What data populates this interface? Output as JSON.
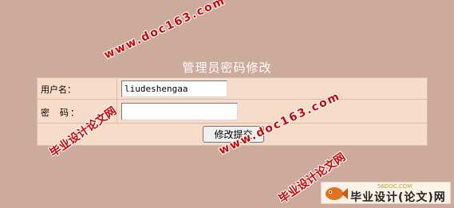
{
  "form": {
    "title": "管理员密码修改",
    "username_label": "用户名：",
    "username_value": "liudeshengaa",
    "password_label": "密  码：",
    "password_value": "",
    "submit_label": "修改提交"
  },
  "watermarks": {
    "url": "www.doc163.com",
    "cn": "毕业设计论文网"
  },
  "logo": {
    "domain": "56DOC.COM",
    "text": "毕业设计(论文)网"
  },
  "colors": {
    "page_background": "#ccab9d",
    "form_background": "#f7dcc9",
    "watermark": "#d40000"
  }
}
